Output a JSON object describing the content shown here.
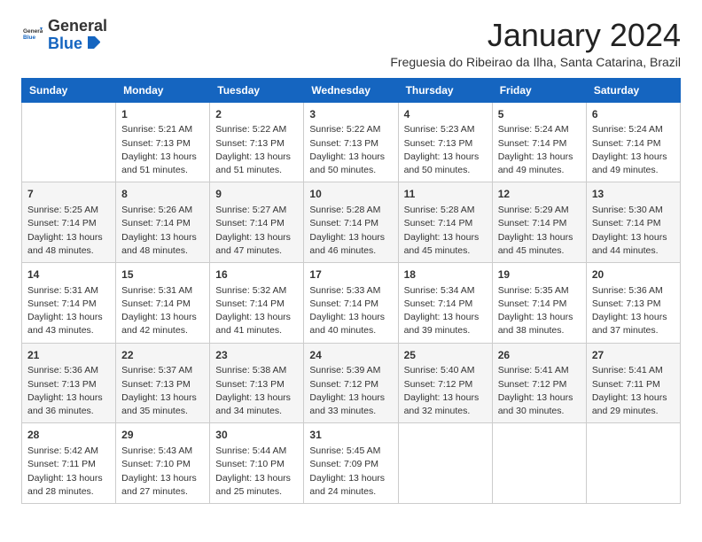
{
  "header": {
    "logo_general": "General",
    "logo_blue": "Blue",
    "month_title": "January 2024",
    "subtitle": "Freguesia do Ribeirao da Ilha, Santa Catarina, Brazil"
  },
  "days_of_week": [
    "Sunday",
    "Monday",
    "Tuesday",
    "Wednesday",
    "Thursday",
    "Friday",
    "Saturday"
  ],
  "weeks": [
    [
      {
        "day": "",
        "info": ""
      },
      {
        "day": "1",
        "info": "Sunrise: 5:21 AM\nSunset: 7:13 PM\nDaylight: 13 hours\nand 51 minutes."
      },
      {
        "day": "2",
        "info": "Sunrise: 5:22 AM\nSunset: 7:13 PM\nDaylight: 13 hours\nand 51 minutes."
      },
      {
        "day": "3",
        "info": "Sunrise: 5:22 AM\nSunset: 7:13 PM\nDaylight: 13 hours\nand 50 minutes."
      },
      {
        "day": "4",
        "info": "Sunrise: 5:23 AM\nSunset: 7:13 PM\nDaylight: 13 hours\nand 50 minutes."
      },
      {
        "day": "5",
        "info": "Sunrise: 5:24 AM\nSunset: 7:14 PM\nDaylight: 13 hours\nand 49 minutes."
      },
      {
        "day": "6",
        "info": "Sunrise: 5:24 AM\nSunset: 7:14 PM\nDaylight: 13 hours\nand 49 minutes."
      }
    ],
    [
      {
        "day": "7",
        "info": "Sunrise: 5:25 AM\nSunset: 7:14 PM\nDaylight: 13 hours\nand 48 minutes."
      },
      {
        "day": "8",
        "info": "Sunrise: 5:26 AM\nSunset: 7:14 PM\nDaylight: 13 hours\nand 48 minutes."
      },
      {
        "day": "9",
        "info": "Sunrise: 5:27 AM\nSunset: 7:14 PM\nDaylight: 13 hours\nand 47 minutes."
      },
      {
        "day": "10",
        "info": "Sunrise: 5:28 AM\nSunset: 7:14 PM\nDaylight: 13 hours\nand 46 minutes."
      },
      {
        "day": "11",
        "info": "Sunrise: 5:28 AM\nSunset: 7:14 PM\nDaylight: 13 hours\nand 45 minutes."
      },
      {
        "day": "12",
        "info": "Sunrise: 5:29 AM\nSunset: 7:14 PM\nDaylight: 13 hours\nand 45 minutes."
      },
      {
        "day": "13",
        "info": "Sunrise: 5:30 AM\nSunset: 7:14 PM\nDaylight: 13 hours\nand 44 minutes."
      }
    ],
    [
      {
        "day": "14",
        "info": "Sunrise: 5:31 AM\nSunset: 7:14 PM\nDaylight: 13 hours\nand 43 minutes."
      },
      {
        "day": "15",
        "info": "Sunrise: 5:31 AM\nSunset: 7:14 PM\nDaylight: 13 hours\nand 42 minutes."
      },
      {
        "day": "16",
        "info": "Sunrise: 5:32 AM\nSunset: 7:14 PM\nDaylight: 13 hours\nand 41 minutes."
      },
      {
        "day": "17",
        "info": "Sunrise: 5:33 AM\nSunset: 7:14 PM\nDaylight: 13 hours\nand 40 minutes."
      },
      {
        "day": "18",
        "info": "Sunrise: 5:34 AM\nSunset: 7:14 PM\nDaylight: 13 hours\nand 39 minutes."
      },
      {
        "day": "19",
        "info": "Sunrise: 5:35 AM\nSunset: 7:14 PM\nDaylight: 13 hours\nand 38 minutes."
      },
      {
        "day": "20",
        "info": "Sunrise: 5:36 AM\nSunset: 7:13 PM\nDaylight: 13 hours\nand 37 minutes."
      }
    ],
    [
      {
        "day": "21",
        "info": "Sunrise: 5:36 AM\nSunset: 7:13 PM\nDaylight: 13 hours\nand 36 minutes."
      },
      {
        "day": "22",
        "info": "Sunrise: 5:37 AM\nSunset: 7:13 PM\nDaylight: 13 hours\nand 35 minutes."
      },
      {
        "day": "23",
        "info": "Sunrise: 5:38 AM\nSunset: 7:13 PM\nDaylight: 13 hours\nand 34 minutes."
      },
      {
        "day": "24",
        "info": "Sunrise: 5:39 AM\nSunset: 7:12 PM\nDaylight: 13 hours\nand 33 minutes."
      },
      {
        "day": "25",
        "info": "Sunrise: 5:40 AM\nSunset: 7:12 PM\nDaylight: 13 hours\nand 32 minutes."
      },
      {
        "day": "26",
        "info": "Sunrise: 5:41 AM\nSunset: 7:12 PM\nDaylight: 13 hours\nand 30 minutes."
      },
      {
        "day": "27",
        "info": "Sunrise: 5:41 AM\nSunset: 7:11 PM\nDaylight: 13 hours\nand 29 minutes."
      }
    ],
    [
      {
        "day": "28",
        "info": "Sunrise: 5:42 AM\nSunset: 7:11 PM\nDaylight: 13 hours\nand 28 minutes."
      },
      {
        "day": "29",
        "info": "Sunrise: 5:43 AM\nSunset: 7:10 PM\nDaylight: 13 hours\nand 27 minutes."
      },
      {
        "day": "30",
        "info": "Sunrise: 5:44 AM\nSunset: 7:10 PM\nDaylight: 13 hours\nand 25 minutes."
      },
      {
        "day": "31",
        "info": "Sunrise: 5:45 AM\nSunset: 7:09 PM\nDaylight: 13 hours\nand 24 minutes."
      },
      {
        "day": "",
        "info": ""
      },
      {
        "day": "",
        "info": ""
      },
      {
        "day": "",
        "info": ""
      }
    ]
  ]
}
